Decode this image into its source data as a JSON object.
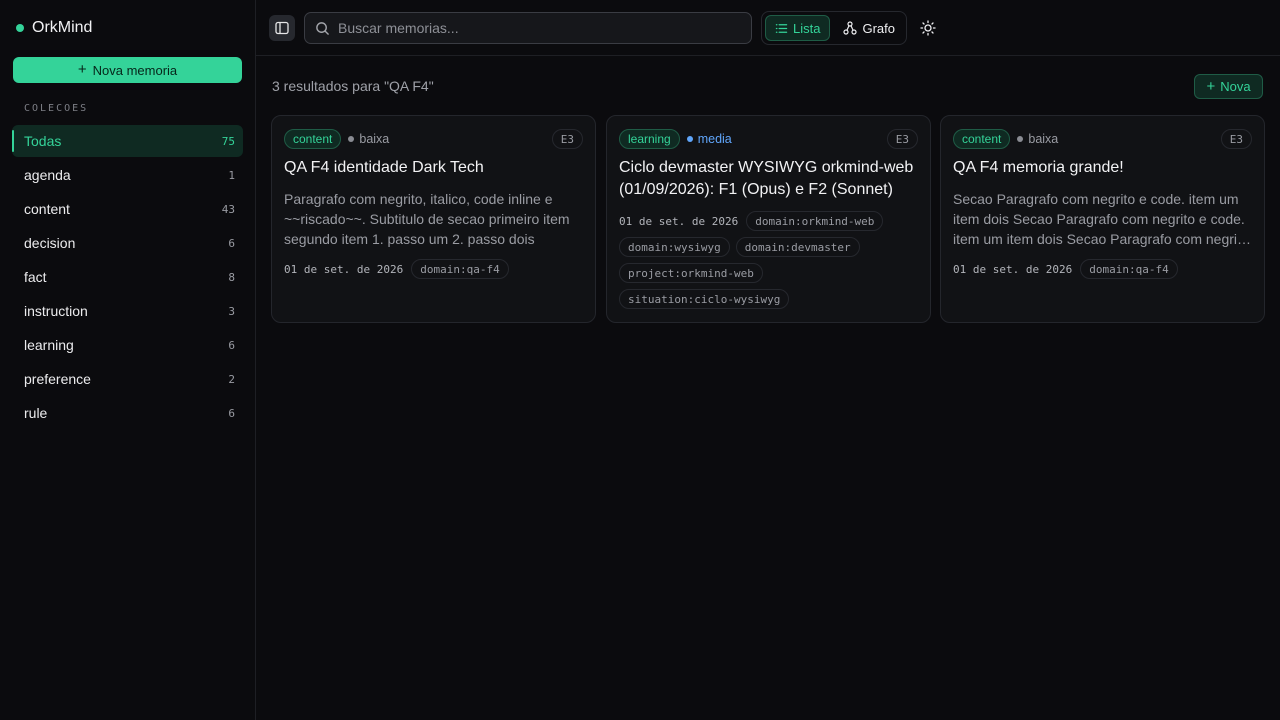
{
  "app": {
    "name": "OrkMind",
    "accent": "#34d399"
  },
  "sidebar": {
    "new_button": "Nova memoria",
    "section_label": "COLECOES",
    "items": [
      {
        "label": "Todas",
        "count": "75",
        "active": true
      },
      {
        "label": "agenda",
        "count": "1"
      },
      {
        "label": "content",
        "count": "43"
      },
      {
        "label": "decision",
        "count": "6"
      },
      {
        "label": "fact",
        "count": "8"
      },
      {
        "label": "instruction",
        "count": "3"
      },
      {
        "label": "learning",
        "count": "6"
      },
      {
        "label": "preference",
        "count": "2"
      },
      {
        "label": "rule",
        "count": "6"
      }
    ]
  },
  "topbar": {
    "search_placeholder": "Buscar memorias...",
    "view_list": "Lista",
    "view_graph": "Grafo",
    "active_view": "Lista"
  },
  "main": {
    "results_text": "3 resultados para \"QA F4\"",
    "new_button": "Nova"
  },
  "cards": [
    {
      "type": "content",
      "priority": "baixa",
      "level": "E3",
      "title": "QA F4 identidade Dark Tech",
      "body": "Paragrafo com negrito, italico, code inline e ~~riscado~~. Subtitulo de secao primeiro item segundo item 1. passo um 2. passo dois",
      "date": "01 de set. de 2026",
      "tags": [
        "domain:qa-f4"
      ]
    },
    {
      "type": "learning",
      "priority": "media",
      "level": "E3",
      "title": "Ciclo devmaster WYSIWYG orkmind-web (01/09/2026): F1 (Opus) e F2 (Sonnet)",
      "body": "",
      "date": "01 de set. de 2026",
      "tags": [
        "domain:orkmind-web",
        "domain:wysiwyg",
        "domain:devmaster",
        "project:orkmind-web",
        "situation:ciclo-wysiwyg"
      ]
    },
    {
      "type": "content",
      "priority": "baixa",
      "level": "E3",
      "title": "QA F4 memoria grande!",
      "body": "Secao Paragrafo com negrito e code. item um item dois Secao Paragrafo com negrito e code. item um item dois Secao Paragrafo com negrito e code.",
      "date": "01 de set. de 2026",
      "tags": [
        "domain:qa-f4"
      ]
    }
  ]
}
